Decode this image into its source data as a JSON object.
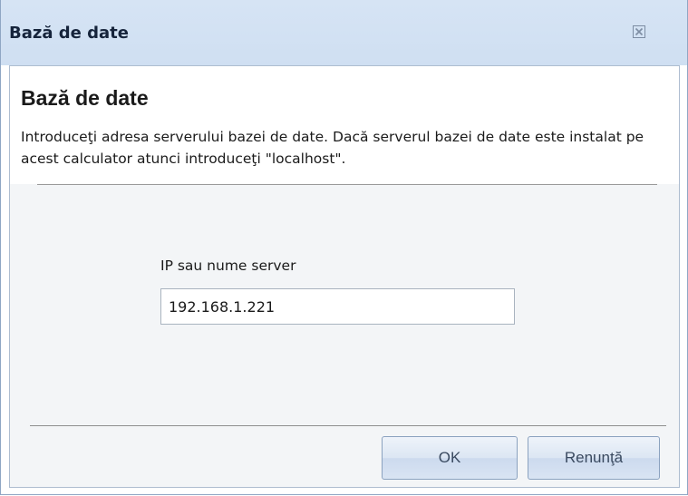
{
  "window": {
    "title": "Bază de date",
    "close_icon": "close-icon"
  },
  "header": {
    "heading": "Bază de date",
    "description": "Introduceţi adresa serverului bazei de date. Dacă serverul bazei de date este instalat pe acest calculator atunci introduceţi \"localhost\"."
  },
  "form": {
    "server_label": "IP sau nume server",
    "server_value": "192.168.1.221"
  },
  "buttons": {
    "ok_label": "OK",
    "cancel_label": "Renunţă"
  },
  "colors": {
    "titlebar": "#d6e4f4",
    "body_background": "#f3f5f7",
    "button_text": "#3a4a60"
  }
}
